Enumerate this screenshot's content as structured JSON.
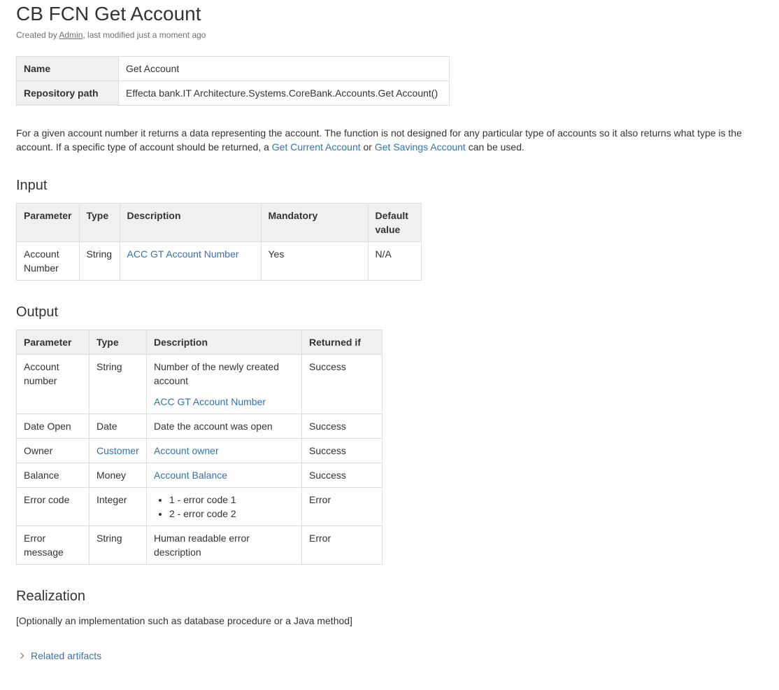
{
  "page": {
    "title": "CB FCN Get Account",
    "byline": {
      "prefix": "Created by ",
      "author": "Admin",
      "suffix": ", last modified just a moment ago"
    }
  },
  "meta": {
    "name_label": "Name",
    "name_value": "Get Account",
    "repo_label": "Repository path",
    "repo_value": "Effecta bank.IT Architecture.Systems.CoreBank.Accounts.Get Account()"
  },
  "intro": {
    "text1": "For a given account number it returns a data representing the account. The function is not designed for any particular type of accounts so it also returns what type is the account. If a specific type of account should be returned, a ",
    "link1": "Get Current Account",
    "text2": " or ",
    "link2": "Get Savings Account",
    "text3": " can be used."
  },
  "input": {
    "heading": "Input",
    "headers": {
      "parameter": "Parameter",
      "type": "Type",
      "description": "Description",
      "mandatory": "Mandatory",
      "default_value": "Default value"
    },
    "rows": [
      {
        "parameter": "Account Number",
        "type": "String",
        "description": "ACC GT Account Number",
        "mandatory": "Yes",
        "default_value": "N/A"
      }
    ]
  },
  "output": {
    "heading": "Output",
    "headers": {
      "parameter": "Parameter",
      "type": "Type",
      "description": "Description",
      "returned_if": "Returned if"
    },
    "rows": [
      {
        "parameter": "Account number",
        "type": "String",
        "description": "Number of the newly created account",
        "description_link": "ACC GT Account Number",
        "returned_if": "Success"
      },
      {
        "parameter": "Date Open",
        "type": "Date",
        "description": "Date the account was open",
        "returned_if": "Success"
      },
      {
        "parameter": "Owner",
        "type": "Customer",
        "description": "Account owner",
        "returned_if": "Success"
      },
      {
        "parameter": "Balance",
        "type": "Money",
        "description": "Account Balance",
        "returned_if": "Success"
      },
      {
        "parameter": "Error code",
        "type": "Integer",
        "description_items": [
          "1 - error code 1",
          "2 - error code 2"
        ],
        "returned_if": "Error"
      },
      {
        "parameter": "Error message",
        "type": "String",
        "description": "Human readable error description",
        "returned_if": "Error"
      }
    ]
  },
  "realization": {
    "heading": "Realization",
    "text": "[Optionally an implementation such as database procedure or a Java method]"
  },
  "related": {
    "label": "Related artifacts"
  },
  "colors": {
    "link": "#3572b0",
    "text": "#333333",
    "header_bg": "#f0f0f0",
    "border": "#dddddd",
    "meta_text": "#707070"
  },
  "icons": {
    "related_toggle": "chevron-right-icon"
  }
}
